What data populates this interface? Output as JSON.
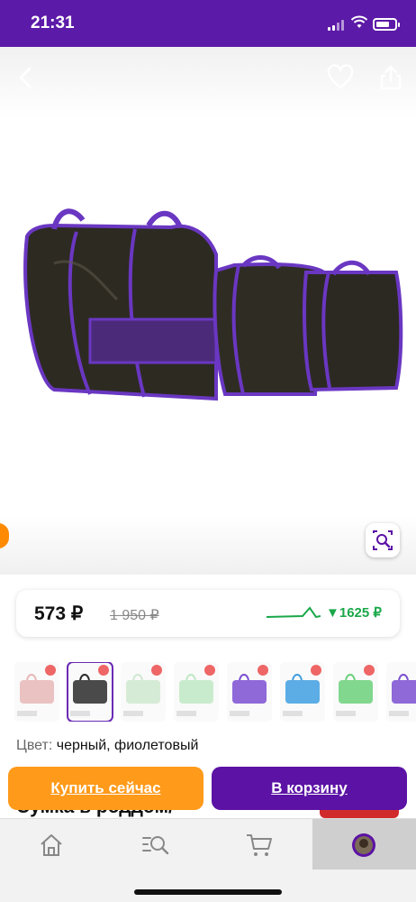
{
  "status_bar": {
    "time": "21:31"
  },
  "product": {
    "price": "573 ₽",
    "old_price": "1 950 ₽",
    "price_change": "▼1625 ₽",
    "color_label": "Цвет:",
    "color_value": "черный, фиолетовый",
    "title_peek": "Сумка в роддом/"
  },
  "thumbnails": [
    {
      "name": "thumb-1",
      "accent": "#e8b7b7"
    },
    {
      "name": "thumb-2",
      "accent": "#2a2a2a",
      "selected": true
    },
    {
      "name": "thumb-3",
      "accent": "#cfe7cf"
    },
    {
      "name": "thumb-4",
      "accent": "#bfe8c4"
    },
    {
      "name": "thumb-5",
      "accent": "#7b4fd1"
    },
    {
      "name": "thumb-6",
      "accent": "#3f9fe0"
    },
    {
      "name": "thumb-7",
      "accent": "#6bd07a"
    },
    {
      "name": "thumb-8",
      "accent": "#7b4fd1"
    }
  ],
  "actions": {
    "buy_now": "Купить сейчас",
    "add_to_cart": "В корзину"
  },
  "tabs": [
    {
      "icon": "home-icon"
    },
    {
      "icon": "catalog-search-icon"
    },
    {
      "icon": "cart-icon"
    },
    {
      "icon": "profile-avatar-icon",
      "active": true
    }
  ],
  "colors": {
    "brand_purple": "#5b12a5",
    "buy_orange": "#ff9a1a",
    "trend_green": "#1aa84a"
  }
}
